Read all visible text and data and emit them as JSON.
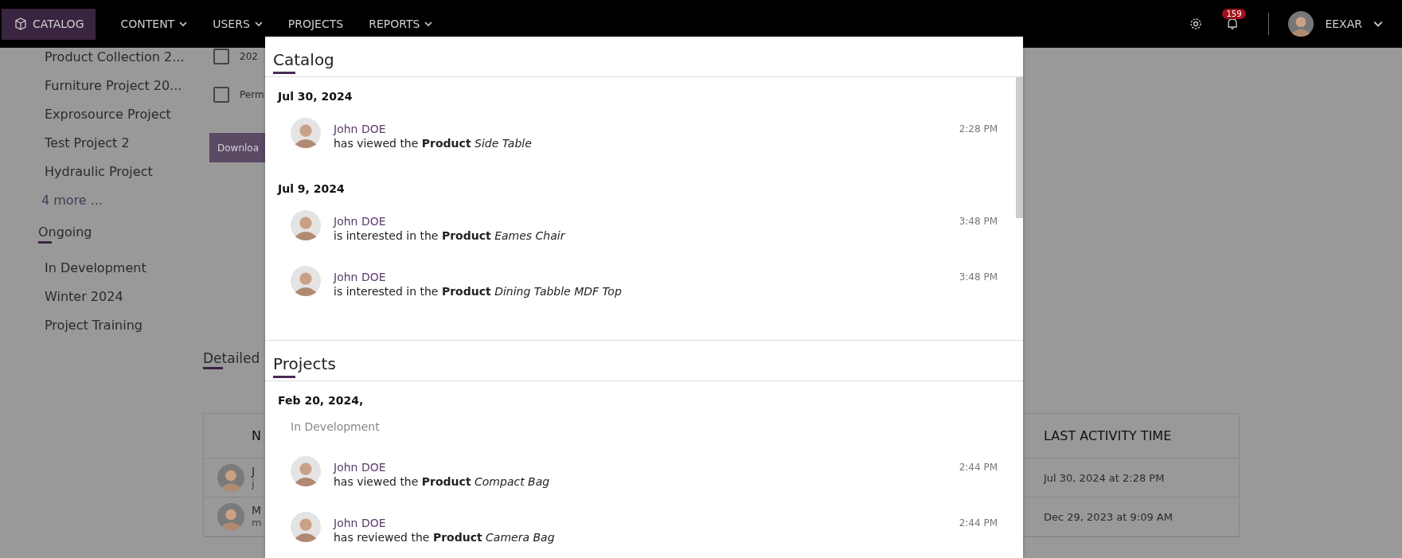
{
  "nav": {
    "items": [
      {
        "label": "CATALOG",
        "kind": "app",
        "selected": true,
        "dropdown": false
      },
      {
        "label": "CONTENT",
        "kind": "menu",
        "selected": false,
        "dropdown": true
      },
      {
        "label": "USERS",
        "kind": "menu",
        "selected": false,
        "dropdown": true
      },
      {
        "label": "PROJECTS",
        "kind": "menu",
        "selected": false,
        "dropdown": false
      },
      {
        "label": "REPORTS",
        "kind": "menu",
        "selected": false,
        "dropdown": true
      }
    ],
    "notifications": "159",
    "user": "EEXAR"
  },
  "sidebar": {
    "items": [
      "Product Collection 2...",
      "Furniture Project 20...",
      "Exprosource Project",
      "Test Project 2",
      "Hydraulic Project"
    ],
    "more": "4 more ...",
    "section": {
      "title": "Ongoing",
      "items": [
        "In Development",
        "Winter 2024",
        "Project Training"
      ]
    }
  },
  "background": {
    "checkboxes": [
      {
        "label": "202",
        "checked": false
      },
      {
        "label": "Perm",
        "checked": false
      }
    ],
    "download_button": "Downloa",
    "section_title": "Detailed",
    "table": {
      "columns": [
        "N",
        "LAST ACTIVITY TIME"
      ],
      "rows": [
        {
          "name": "J",
          "email": "j",
          "last_activity": "Jul 30, 2024 at 2:28 PM"
        },
        {
          "name": "M",
          "email": "m",
          "last_activity": "Dec 29, 2023 at 9:09 AM"
        }
      ]
    }
  },
  "dialog": {
    "sections": [
      {
        "title": "Catalog",
        "scrollable": true,
        "groups": [
          {
            "date": "Jul 30, 2024",
            "entries": [
              {
                "user": "John DOE",
                "action": "has viewed the **Product** *Side Table*",
                "time": "2:28 PM"
              }
            ]
          },
          {
            "date": "Jul 9, 2024",
            "entries": [
              {
                "user": "John DOE",
                "action": "is interested in the **Product** *Eames Chair*",
                "time": "3:48 PM"
              },
              {
                "user": "John DOE",
                "action": "is interested in the **Product** *Dining Tabble MDF Top*",
                "time": "3:48 PM"
              }
            ]
          }
        ]
      },
      {
        "title": "Projects",
        "scrollable": false,
        "groups": [
          {
            "date": "Feb 20, 2024,",
            "project": "In Development",
            "entries": [
              {
                "user": "John DOE",
                "action": "has viewed the **Product** *Compact Bag*",
                "time": "2:44 PM"
              },
              {
                "user": "John DOE",
                "action": "has reviewed the **Product** *Camera Bag*",
                "time": "2:44 PM"
              }
            ]
          }
        ]
      }
    ]
  }
}
